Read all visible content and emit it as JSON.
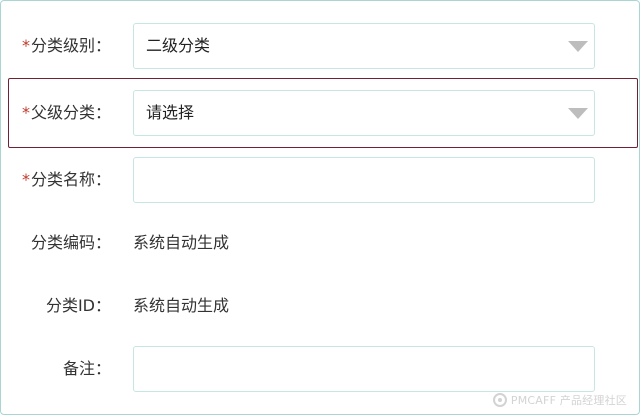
{
  "form": {
    "level": {
      "required": "*",
      "label": "分类级别：",
      "value": "二级分类"
    },
    "parent": {
      "required": "*",
      "label": "父级分类：",
      "value": "请选择"
    },
    "name": {
      "required": "*",
      "label": "分类名称：",
      "value": ""
    },
    "code": {
      "label": "分类编码：",
      "value": "系统自动生成"
    },
    "id": {
      "label": "分类ID：",
      "value": "系统自动生成"
    },
    "note": {
      "label": "备注：",
      "value": ""
    }
  },
  "watermark": {
    "text": "PMCAFF 产品经理社区"
  },
  "colors": {
    "required": "#c0392b",
    "field_border": "#c6e6e3",
    "highlight": "#6e2233",
    "caret": "#bdbdbd"
  }
}
